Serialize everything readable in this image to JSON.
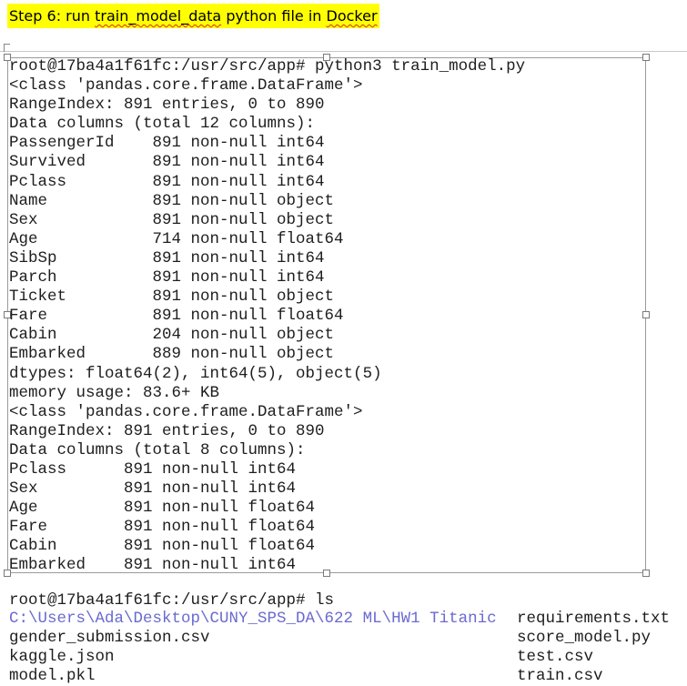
{
  "heading": {
    "prefix": "Step 6: run ",
    "underlined1": "train_model_data",
    "middle": " python file in ",
    "underlined2": "Docker"
  },
  "terminal_lines": [
    "root@17ba4a1f61fc:/usr/src/app# python3 train_model.py",
    "<class 'pandas.core.frame.DataFrame'>",
    "RangeIndex: 891 entries, 0 to 890",
    "Data columns (total 12 columns):",
    "PassengerId    891 non-null int64",
    "Survived       891 non-null int64",
    "Pclass         891 non-null int64",
    "Name           891 non-null object",
    "Sex            891 non-null object",
    "Age            714 non-null float64",
    "SibSp          891 non-null int64",
    "Parch          891 non-null int64",
    "Ticket         891 non-null object",
    "Fare           891 non-null float64",
    "Cabin          204 non-null object",
    "Embarked       889 non-null object",
    "dtypes: float64(2), int64(5), object(5)",
    "memory usage: 83.6+ KB",
    "<class 'pandas.core.frame.DataFrame'>",
    "RangeIndex: 891 entries, 0 to 890",
    "Data columns (total 8 columns):",
    "Pclass      891 non-null int64",
    "Sex         891 non-null int64",
    "Age         891 non-null float64",
    "Fare        891 non-null float64",
    "Cabin       891 non-null float64",
    "Embarked    891 non-null int64"
  ],
  "ls_output": {
    "prompt": "root@17ba4a1f61fc:/usr/src/app# ls",
    "left_column": [
      "C:\\Users\\Ada\\Desktop\\CUNY_SPS_DA\\622 ML\\HW1 Titanic",
      "gender_submission.csv",
      "kaggle.json",
      "model.pkl"
    ],
    "right_column": [
      "requirements.txt",
      "score_model.py",
      "test.csv",
      "train.csv"
    ]
  },
  "colors": {
    "heading_highlight": "#ffff00",
    "text": "#1e1e1e",
    "path_link": "#6a6ad0"
  }
}
